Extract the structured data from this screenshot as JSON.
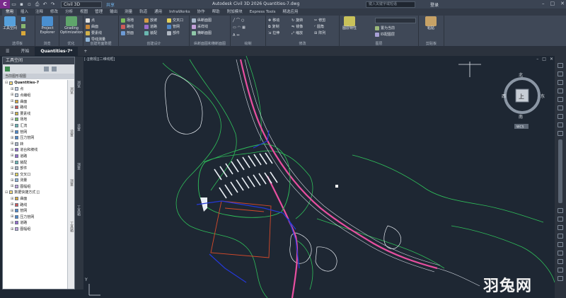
{
  "qat": {
    "logo": "C",
    "workspace": "Civil 3D",
    "share": "共享"
  },
  "window": {
    "title": "Autodesk Civil 3D 2026    Quantities-7.dwg",
    "search_placeholder": "键入关键字或短语",
    "login": "登录"
  },
  "tabs": [
    "常用",
    "插入",
    "注释",
    "修改",
    "分析",
    "视图",
    "管理",
    "输出",
    "测量",
    "轨道",
    "通用",
    "InfraWorks",
    "协作",
    "帮助",
    "附加模块",
    "Express Tools",
    "精选应用"
  ],
  "active_tab": "常用",
  "ribbon": {
    "panel1": {
      "btn1": "工具空间",
      "btn1_sub": "选项板"
    },
    "panel2": {
      "btn1": "Project Explorer",
      "title": "浏览"
    },
    "panel3": {
      "btn1": "Grading Optimization",
      "title": "优化"
    },
    "panel4": {
      "items": [
        "点",
        "曲面",
        "要素线",
        "导线测量"
      ],
      "title": "创建地面数据"
    },
    "panel5": {
      "items": [
        "场地",
        "路线",
        "剖面",
        "放坡",
        "道路",
        "装配",
        "交叉口",
        "管网",
        "部件"
      ],
      "title": "创建设计"
    },
    "panel6": {
      "items": [
        "纵断面图",
        "采样线",
        "横断面图"
      ],
      "title": "纵断面图和横断面图"
    },
    "panel7": {
      "title": "绘制"
    },
    "panel8": {
      "items": [
        "移动",
        "旋转",
        "复制",
        "镜像",
        "拉伸",
        "缩放",
        "修剪",
        "圆角",
        "阵列"
      ],
      "title": "修改"
    },
    "panel9": {
      "items": [
        "图层特性",
        "置为当前",
        "匹配图层"
      ],
      "title": "图层"
    },
    "panel10": {
      "items": [
        "粘贴"
      ],
      "title": "剪贴板"
    }
  },
  "doc_tabs": [
    "开始",
    "Quantities-7*"
  ],
  "palette": {
    "header": "工具空间",
    "view_title": "当前图形视图",
    "tree": [
      "Quantities-7",
      "点",
      "点编组",
      "曲面",
      "路线",
      "要素线",
      "场地",
      "汇流",
      "管网",
      "压力管网",
      "转",
      "道台和坡线",
      "道路",
      "装配",
      "部件",
      "交叉口",
      "测量",
      "图幅组",
      "数据快捷方式 []",
      "曲面",
      "路线",
      "管网",
      "压力管网",
      "道路",
      "图幅组"
    ],
    "vtabs": [
      "浏览",
      "设置",
      "测量",
      "工具箱"
    ]
  },
  "viewport": {
    "label": "[-][俯视][二维线框]",
    "compass": {
      "n": "北",
      "s": "南",
      "e": "东",
      "w": "西",
      "top": "上",
      "wcs": "WCS"
    },
    "axis_y": "Y"
  },
  "watermark": "羽兔网",
  "colors": {
    "accent": "#6fb0e6",
    "road": "#e84fa0",
    "parcel": "#2fbf5a",
    "pipe": "#2438d8",
    "boundary": "#d64a2a"
  }
}
